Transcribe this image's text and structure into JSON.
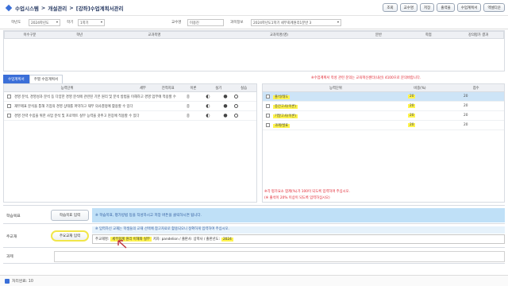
{
  "breadcrumb": [
    "수업시스템",
    ">",
    "개설관리",
    ">",
    "[강좌]수업계획서관리"
  ],
  "toolbar": [
    "조회",
    "교수명",
    "저장",
    "출력물",
    "수업계획서",
    "엑셀다운"
  ],
  "filter": {
    "year_label": "학년도",
    "year_value": "2024학년도",
    "term_label": "학기",
    "term_value": "1학기",
    "prof_label": "교수명",
    "prof_value": "이용진",
    "course_label": "과목정보",
    "course_value": "2024학년도1학기 세무회계원리1분반 3",
    "empty1": "",
    "empty2": ""
  },
  "grid1_headers": [
    "이수구분",
    "학년",
    "교과목명",
    "교과목명(영)",
    "분반",
    "학점",
    "강의평가 결과"
  ],
  "grid1_notice": "※수업계획서 작성 관련 문의는 교육혁신센터(내선) 4100으로 문의바랍니다.",
  "tabs": [
    "수업계획서",
    "주별 수업계획서"
  ],
  "left_headers": [
    "능력단위",
    "세부",
    "전적지표",
    "이론",
    "실기",
    "실습"
  ],
  "left_rows": [
    {
      "text": "경영 분석, 경영성과 분석 등 다양한 경영 분석에 관련된 기본 원리 및 분석 방법을 이해하고 경영 업무에 적용할 수 있다",
      "v": "중",
      "m1": "◐",
      "m2": "●"
    },
    {
      "text": "재무제표 분석을 통해 기업의 경영 상태를 파악하고 재무 의사결정에 활용할 수 있다",
      "v": "중",
      "m1": "◐",
      "m2": "●"
    },
    {
      "text": "경영 전략 수립을 위한 사업 분석 및 프로젝트 실무 능력을 갖추고 현장에 적용할 수 있다",
      "v": "중",
      "m1": "◐",
      "m2": "●"
    }
  ],
  "right_headers": [
    "",
    "능력단위",
    "비중(%)",
    "점수"
  ],
  "right_rows": [
    {
      "name": "출석/태도",
      "w": "20",
      "s": "20"
    },
    {
      "name": "중간고사(이론)",
      "w": "20",
      "s": "20"
    },
    {
      "name": "기말고사(이론)",
      "w": "20",
      "s": "20"
    },
    {
      "name": "과제/발표",
      "w": "20",
      "s": "20"
    }
  ],
  "right_notice1": "※각 평가요소 합계(%)가 100이 되도록 입력하여 주십시오.",
  "right_notice2": "(※ 출석이 20% 이상이 되도록 입력하십시오)",
  "sec1": {
    "label": "학습목표",
    "btn": "학습목표 입력",
    "bar": "※ 학습목표, 평가방법 등을 작성하시고 저장 버튼을 클릭하시면 됩니다."
  },
  "sec2": {
    "label": "주교재",
    "btn": "주요교재 입력",
    "note": "※ 입력하신 교재는 학생들의 교재 선택에 참고자료로 활용되오니 정확하게 입력하여 주십시오.",
    "textline_pre": "주교재명:",
    "textline_hl": "세무회계 원리 이해와 실무",
    "textline_mid": "저자: pandelion / 출판사: 상학사 / 출판년도:",
    "textline_hl2": "2024"
  },
  "sec3": {
    "label": "과제"
  },
  "status": "처리완료: 10"
}
